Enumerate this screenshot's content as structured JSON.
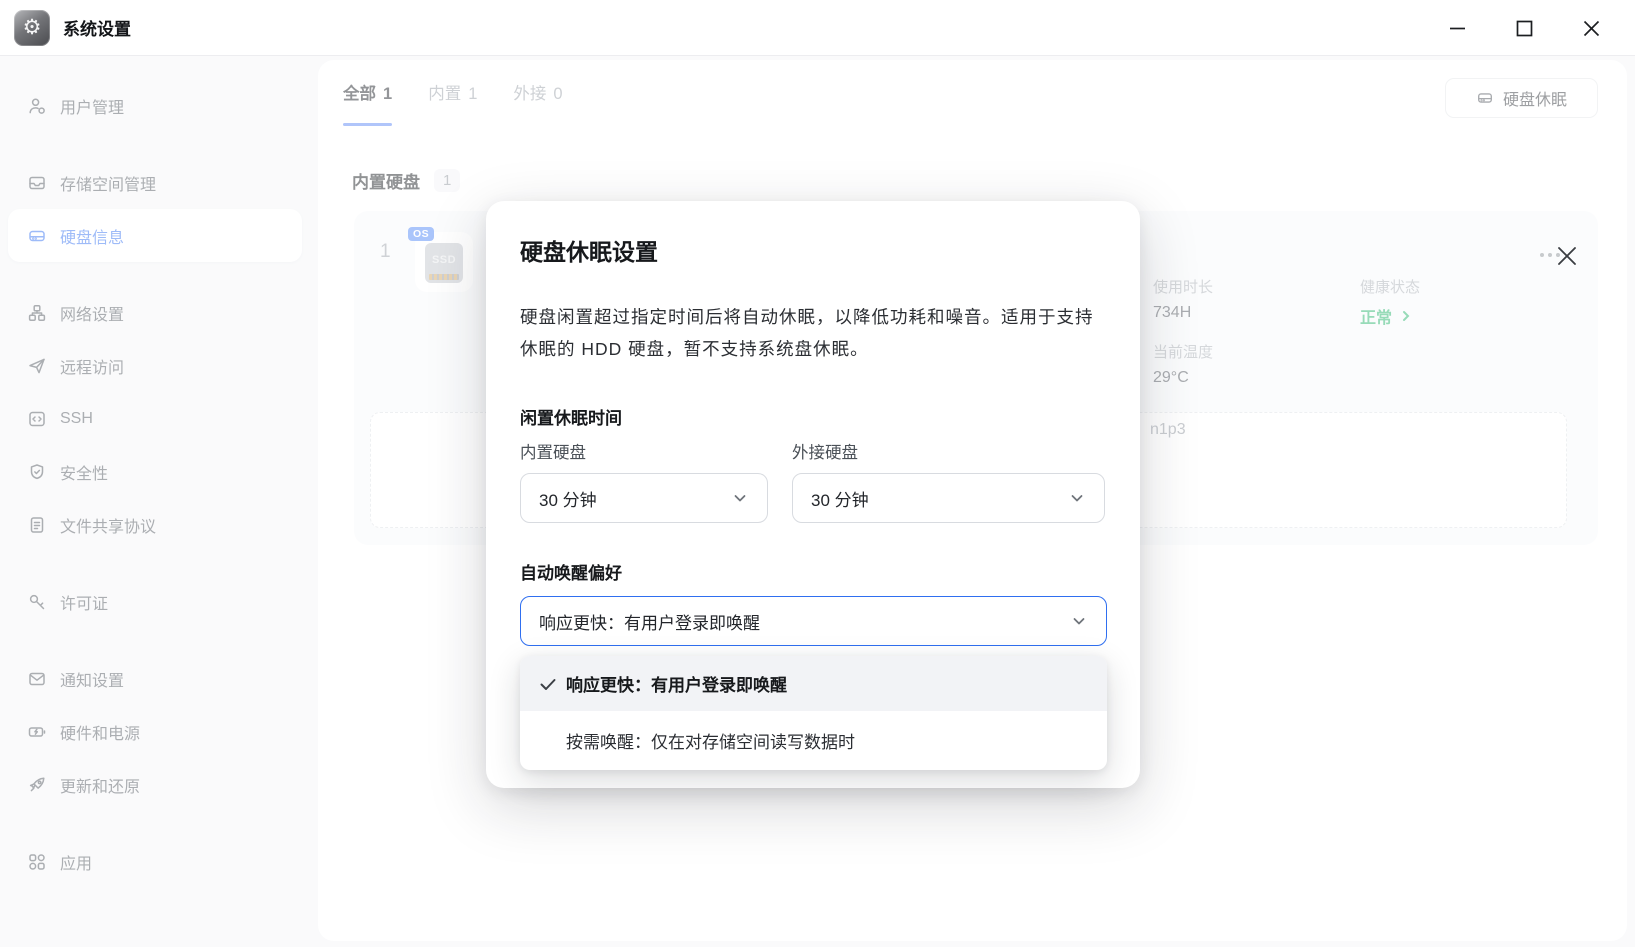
{
  "colors": {
    "accent": "#3672f0",
    "health_green": "#27b36c"
  },
  "titlebar": {
    "app_title": "系统设置"
  },
  "sidebar": {
    "items": [
      {
        "label": "用户管理",
        "icon": "user-icon"
      },
      {
        "label": "存储空间管理",
        "icon": "storage-icon"
      },
      {
        "label": "硬盘信息",
        "icon": "disk-icon",
        "selected": true
      },
      {
        "label": "网络设置",
        "icon": "network-icon"
      },
      {
        "label": "远程访问",
        "icon": "remote-icon"
      },
      {
        "label": "SSH",
        "icon": "ssh-icon"
      },
      {
        "label": "安全性",
        "icon": "security-icon"
      },
      {
        "label": "文件共享协议",
        "icon": "file-share-icon"
      },
      {
        "label": "许可证",
        "icon": "license-icon"
      },
      {
        "label": "通知设置",
        "icon": "notification-icon"
      },
      {
        "label": "硬件和电源",
        "icon": "power-icon"
      },
      {
        "label": "更新和还原",
        "icon": "update-icon"
      },
      {
        "label": "应用",
        "icon": "apps-icon"
      }
    ]
  },
  "main": {
    "tabs": [
      {
        "label": "全部",
        "count": "1",
        "active": true
      },
      {
        "label": "内置",
        "count": "1",
        "active": false
      },
      {
        "label": "外接",
        "count": "0",
        "active": false
      }
    ],
    "sleep_button_label": "硬盘休眠",
    "section_title": "内置硬盘",
    "section_count": "1",
    "disk": {
      "index": "1",
      "os_badge": "OS",
      "ssd_label": "SSD",
      "stats": [
        {
          "label": "使用时长",
          "value": "734H"
        },
        {
          "label": "健康状态",
          "value": "正常"
        },
        {
          "label": "当前温度",
          "value": "29°C"
        }
      ],
      "partition_text": "n1p3"
    }
  },
  "modal": {
    "title": "硬盘休眠设置",
    "description": "硬盘闲置超过指定时间后将自动休眠，以降低功耗和噪音。适用于支持休眠的 HDD 硬盘，暂不支持系统盘休眠。",
    "idle_section_title": "闲置休眠时间",
    "internal_label": "内置硬盘",
    "internal_value": "30 分钟",
    "external_label": "外接硬盘",
    "external_value": "30 分钟",
    "wake_section_title": "自动唤醒偏好",
    "wake_value": "响应更快：有用户登录即唤醒",
    "options": [
      {
        "label": "响应更快：有用户登录即唤醒",
        "selected": true
      },
      {
        "label": "按需唤醒：仅在对存储空间读写数据时",
        "selected": false
      }
    ]
  }
}
